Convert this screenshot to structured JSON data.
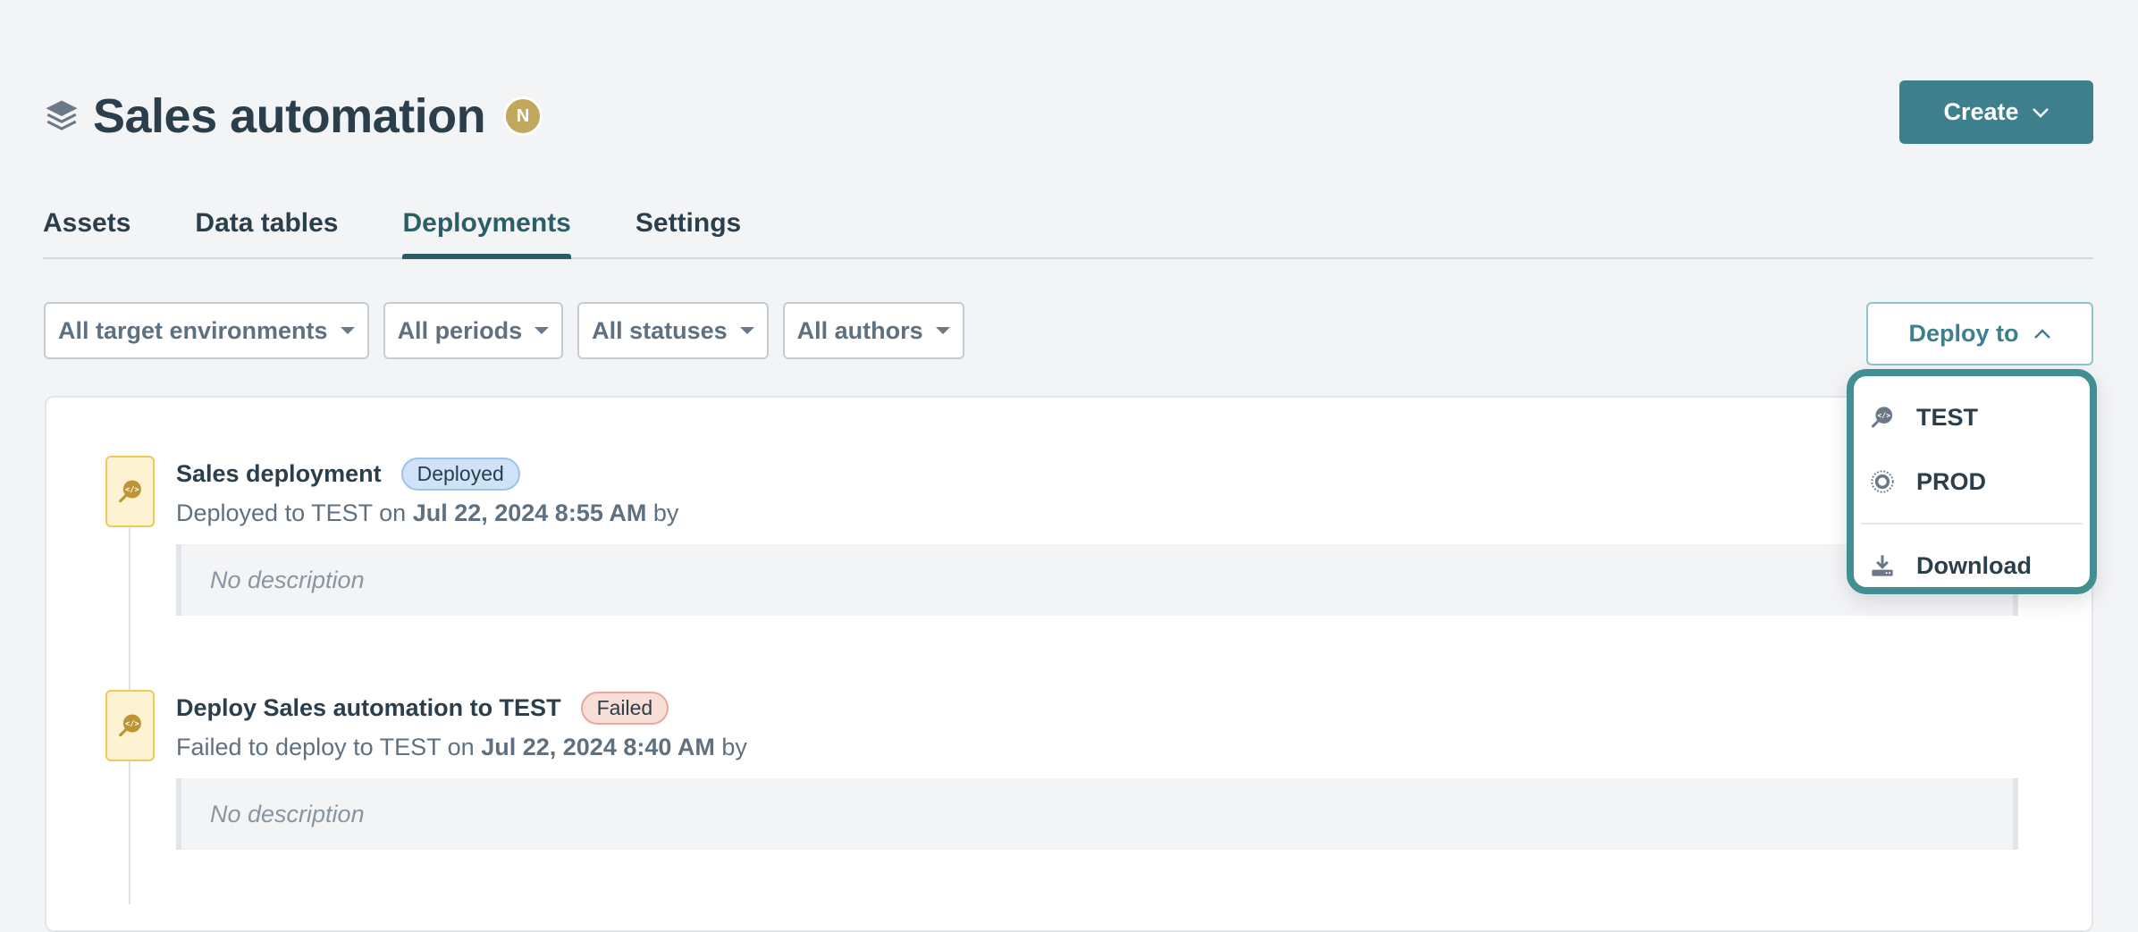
{
  "header": {
    "title": "Sales automation",
    "owner_badge": "N",
    "create_label": "Create"
  },
  "tabs": [
    {
      "label": "Assets",
      "active": false
    },
    {
      "label": "Data tables",
      "active": false
    },
    {
      "label": "Deployments",
      "active": true
    },
    {
      "label": "Settings",
      "active": false
    }
  ],
  "filters": [
    {
      "label": "All target environments"
    },
    {
      "label": "All periods"
    },
    {
      "label": "All statuses"
    },
    {
      "label": "All authors"
    }
  ],
  "deploy_button": {
    "label": "Deploy to"
  },
  "deploy_menu": {
    "items": [
      {
        "label": "TEST",
        "icon": "test-env-icon"
      },
      {
        "label": "PROD",
        "icon": "prod-env-icon"
      },
      {
        "label": "Download",
        "icon": "download-icon"
      }
    ]
  },
  "deployments": [
    {
      "title": "Sales deployment",
      "status": "Deployed",
      "sub_prefix": "Deployed to TEST on",
      "date": "Jul 22, 2024 8:55 AM",
      "sub_suffix": "by",
      "description": "No description"
    },
    {
      "title": "Deploy Sales automation to TEST",
      "status": "Failed",
      "sub_prefix": "Failed to deploy to TEST on",
      "date": "Jul 22, 2024 8:40 AM",
      "sub_suffix": "by",
      "description": "No description"
    }
  ],
  "colors": {
    "accent": "#3d7f8c",
    "menu_border": "#418f91",
    "deployed_badge": "#cfe2f8",
    "failed_badge": "#f9ddd7",
    "owner_badge": "#c2a85c"
  }
}
